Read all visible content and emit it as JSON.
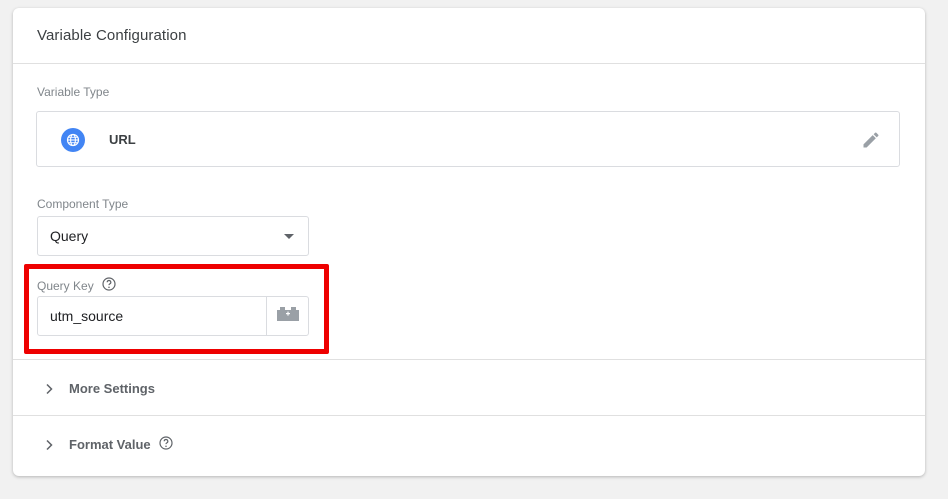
{
  "card": {
    "title": "Variable Configuration"
  },
  "variable_type": {
    "label": "Variable Type",
    "value": "URL",
    "icon": "globe-icon",
    "edit_icon": "pencil-icon"
  },
  "component_type": {
    "label": "Component Type",
    "selected": "Query"
  },
  "query_key": {
    "label": "Query Key",
    "value": "utm_source",
    "help_icon": "help-circle-icon",
    "variable_button_icon": "lego-brick-icon",
    "highlight_color": "#ee0000"
  },
  "sections": {
    "more_settings": "More Settings",
    "format_value": "Format Value"
  },
  "colors": {
    "accent": "#4285f4",
    "label": "#80868b",
    "border": "#dadce0"
  }
}
